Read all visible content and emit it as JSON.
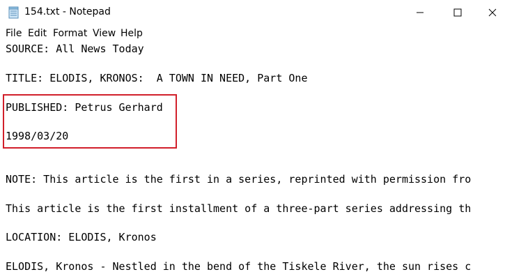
{
  "window": {
    "title": "154.txt - Notepad",
    "icon": "notepad-icon"
  },
  "menu": {
    "items": [
      "File",
      "Edit",
      "Format",
      "View",
      "Help"
    ]
  },
  "document": {
    "lines": [
      "SOURCE: All News Today",
      "",
      "TITLE: ELODIS, KRONOS:  A TOWN IN NEED, Part One",
      "",
      "PUBLISHED: Petrus Gerhard",
      "",
      "1998/03/20",
      "",
      "",
      "NOTE: This article is the first in a series, reprinted with permission fro",
      "",
      "This article is the first installment of a three-part series addressing th",
      "",
      "LOCATION: ELODIS, Kronos",
      "",
      "ELODIS, Kronos - Nestled in the bend of the Tiskele River, the sun rises c"
    ]
  },
  "annotation": {
    "highlight_color": "#d11f2a"
  }
}
